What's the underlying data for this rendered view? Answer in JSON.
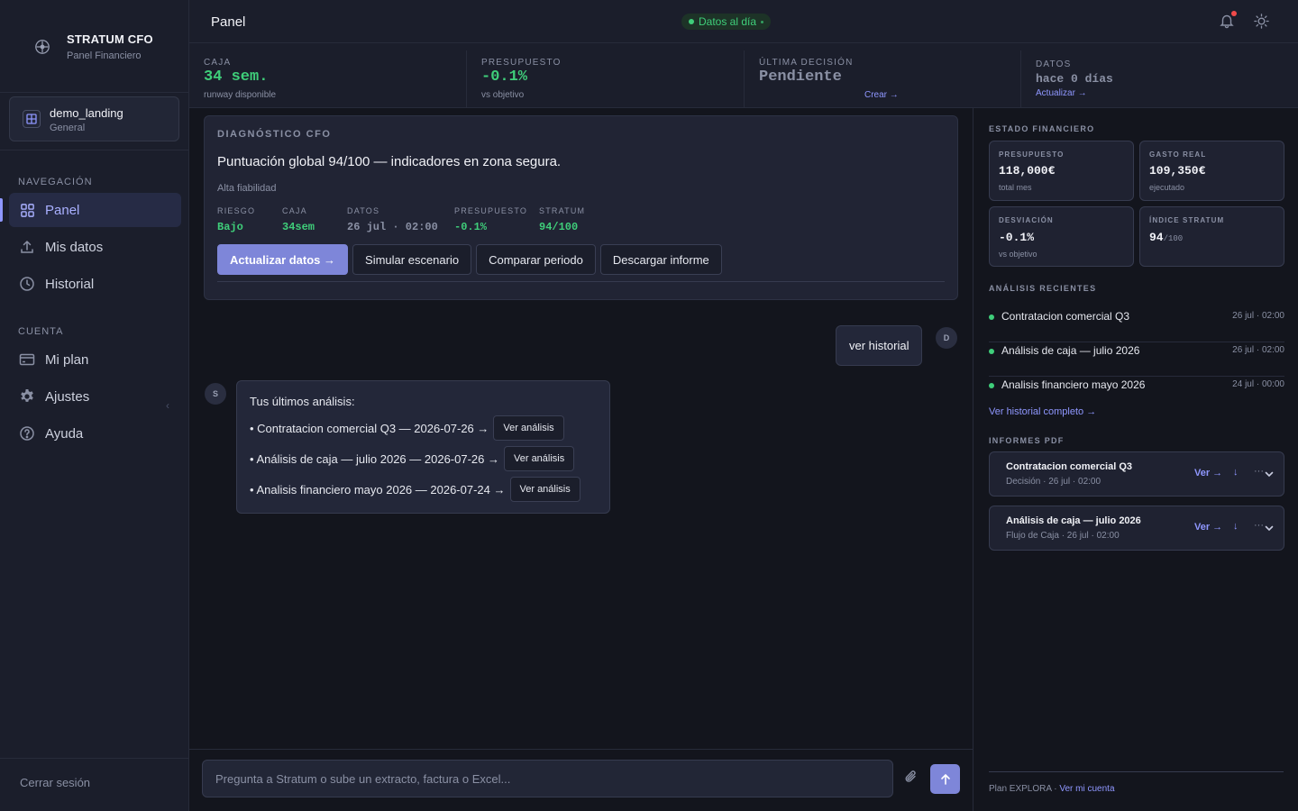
{
  "sidebar": {
    "brand_title": "STRATUM CFO",
    "brand_subtitle": "Panel Financiero",
    "workspace": {
      "name": "demo_landing",
      "subtitle": "General"
    },
    "nav_section": "NAVEGACIÓN",
    "nav_items": [
      {
        "label": "Panel",
        "icon": "grid-icon",
        "active": true
      },
      {
        "label": "Mis datos",
        "icon": "upload-icon"
      },
      {
        "label": "Historial",
        "icon": "clock-icon"
      }
    ],
    "account_section": "CUENTA",
    "account_items": [
      {
        "label": "Mi plan",
        "icon": "credit-card-icon"
      },
      {
        "label": "Ajustes",
        "icon": "gear-icon"
      },
      {
        "label": "Ayuda",
        "icon": "help-icon"
      }
    ],
    "logout_label": "Cerrar sesión"
  },
  "header": {
    "title": "Panel",
    "status": "Datos al día"
  },
  "kpis": {
    "caja": {
      "label": "CAJA",
      "value": "34 sem.",
      "sub": "runway disponible"
    },
    "presupuesto": {
      "label": "PRESUPUESTO",
      "value": "-0.1%",
      "sub": "vs objetivo"
    },
    "decision": {
      "label": "ÚLTIMA DECISIÓN",
      "value": "Pendiente",
      "link": "Crear →"
    },
    "datos": {
      "label": "DATOS",
      "value": "hace 0 días",
      "link": "Actualizar →"
    }
  },
  "diagnostico": {
    "label": "DIAGNÓSTICO CFO",
    "headline": "Puntuación global 94/100 — indicadores en zona segura.",
    "reliability": "Alta fiabilidad",
    "metrics": [
      {
        "label": "RIESGO",
        "value": "Bajo"
      },
      {
        "label": "CAJA",
        "value": "34sem"
      },
      {
        "label": "DATOS",
        "value": "26 jul · 02:00"
      },
      {
        "label": "PRESUPUESTO",
        "value": "-0.1%"
      },
      {
        "label": "STRATUM",
        "value": "94/100"
      }
    ],
    "buttons": {
      "primary": "Actualizar datos →",
      "simular": "Simular escenario",
      "comparar": "Comparar periodo",
      "descargar": "Descargar informe"
    }
  },
  "chat": {
    "user_initial": "D",
    "user_message": "ver historial",
    "bot_initial": "S",
    "bot_title": "Tus últimos análisis:",
    "bot_items": [
      "• Contratacion comercial Q3 — 2026-07-26 →",
      "• Análisis de caja — julio 2026 — 2026-07-26 →",
      "• Analisis financiero mayo 2026 — 2026-07-24 →"
    ],
    "bot_button": "Ver análisis",
    "input_placeholder": "Pregunta a Stratum o sube un extracto, factura o Excel..."
  },
  "right_panel": {
    "estado_label": "ESTADO FINANCIERO",
    "cards": {
      "presupuesto": {
        "label": "PRESUPUESTO",
        "value": "118,000€",
        "sub": "total mes"
      },
      "gasto": {
        "label": "GASTO REAL",
        "value": "109,350€",
        "sub": "ejecutado"
      },
      "desviacion": {
        "label": "DESVIACIÓN",
        "value": "-0.1%",
        "sub": "vs objetivo"
      },
      "indice": {
        "label": "ÍNDICE STRATUM",
        "value": "94",
        "suffix": "/100"
      }
    },
    "recientes_label": "ANÁLISIS RECIENTES",
    "recientes": [
      {
        "name": "Contratacion comercial Q3",
        "time": "26 jul · 02:00"
      },
      {
        "name": "Análisis de caja — julio 2026",
        "time": "26 jul · 02:00"
      },
      {
        "name": "Analisis financiero mayo 2026",
        "time": "24 jul · 00:00"
      }
    ],
    "historial_link": "Ver historial completo →",
    "pdf_label": "INFORMES PDF",
    "pdfs": [
      {
        "title": "Contratacion comercial Q3",
        "sub": "Decisión · 26 jul · 02:00"
      },
      {
        "title": "Análisis de caja — julio 2026",
        "sub": "Flujo de Caja · 26 jul · 02:00"
      }
    ],
    "pdf_view": "Ver →",
    "pdf_download": "↓",
    "pdf_more": "···",
    "plan_text": "Plan EXPLORA · ",
    "plan_link": "Ver mi cuenta"
  }
}
